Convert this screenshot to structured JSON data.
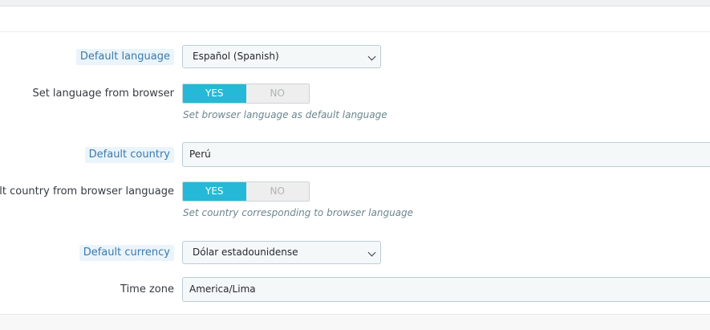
{
  "form": {
    "default_language": {
      "label": "Default language",
      "value": "Español (Spanish)"
    },
    "language_from_browser": {
      "label": "Set language from browser",
      "yes": "YES",
      "no": "NO",
      "selected": "YES",
      "help": "Set browser language as default language"
    },
    "default_country": {
      "label": "Default country",
      "value": "Perú"
    },
    "country_from_browser": {
      "label": "ault country from browser language",
      "yes": "YES",
      "no": "NO",
      "selected": "YES",
      "help": "Set country corresponding to browser language"
    },
    "default_currency": {
      "label": "Default currency",
      "value": "Dólar estadounidense"
    },
    "time_zone": {
      "label": "Time zone",
      "value": "America/Lima"
    }
  },
  "colors": {
    "accent": "#25b9d7",
    "label_highlight_bg": "#eaf4fb",
    "label_highlight_text": "#3c7aa8"
  }
}
